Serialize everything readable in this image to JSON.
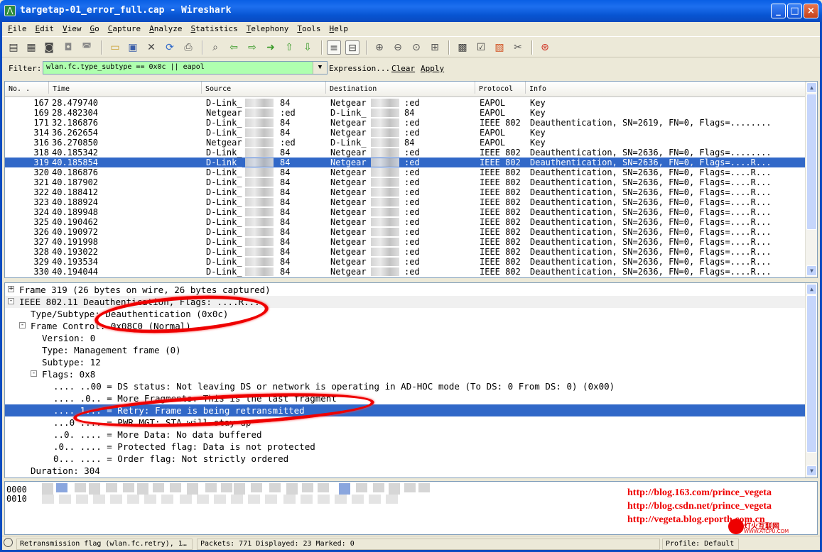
{
  "window": {
    "title": "targetap-01_error_full.cap - Wireshark",
    "min": "_",
    "max": "□",
    "close": "×"
  },
  "menu": [
    "File",
    "Edit",
    "View",
    "Go",
    "Capture",
    "Analyze",
    "Statistics",
    "Telephony",
    "Tools",
    "Help"
  ],
  "filter": {
    "label": "Filter:",
    "value": "wlan.fc.type_subtype == 0x0c || eapol",
    "expression": "Expression...",
    "clear": "Clear",
    "apply": "Apply"
  },
  "packet_list": {
    "columns": [
      "No. .",
      "Time",
      "Source",
      "Destination",
      "Protocol",
      "Info"
    ],
    "rows": [
      {
        "no": "167",
        "time": "28.479740",
        "src": "D-Link_",
        "srcs": "84",
        "dst": "Netgear",
        "dsts": ":ed",
        "proto": "EAPOL",
        "info": "Key"
      },
      {
        "no": "169",
        "time": "28.482304",
        "src": "Netgear",
        "srcs": ":ed",
        "dst": "D-Link_",
        "dsts": "84",
        "proto": "EAPOL",
        "info": "Key"
      },
      {
        "no": "171",
        "time": "32.186876",
        "src": "D-Link_",
        "srcs": "84",
        "dst": "Netgear",
        "dsts": ":ed",
        "proto": "IEEE 802",
        "info": "Deauthentication, SN=2619, FN=0, Flags=........"
      },
      {
        "no": "314",
        "time": "36.262654",
        "src": "D-Link_",
        "srcs": "84",
        "dst": "Netgear",
        "dsts": ":ed",
        "proto": "EAPOL",
        "info": "Key"
      },
      {
        "no": "316",
        "time": "36.270850",
        "src": "Netgear",
        "srcs": ":ed",
        "dst": "D-Link_",
        "dsts": "84",
        "proto": "EAPOL",
        "info": "Key"
      },
      {
        "no": "318",
        "time": "40.185342",
        "src": "D-Link_",
        "srcs": "84",
        "dst": "Netgear",
        "dsts": ":ed",
        "proto": "IEEE 802",
        "info": "Deauthentication, SN=2636, FN=0, Flags=........"
      },
      {
        "no": "319",
        "time": "40.185854",
        "src": "D-Link_",
        "srcs": "84",
        "dst": "Netgear",
        "dsts": ":ed",
        "proto": "IEEE 802",
        "info": "Deauthentication, SN=2636, FN=0, Flags=....R..."
      },
      {
        "no": "320",
        "time": "40.186876",
        "src": "D-Link_",
        "srcs": "84",
        "dst": "Netgear",
        "dsts": ":ed",
        "proto": "IEEE 802",
        "info": "Deauthentication, SN=2636, FN=0, Flags=....R..."
      },
      {
        "no": "321",
        "time": "40.187902",
        "src": "D-Link_",
        "srcs": "84",
        "dst": "Netgear",
        "dsts": ":ed",
        "proto": "IEEE 802",
        "info": "Deauthentication, SN=2636, FN=0, Flags=....R..."
      },
      {
        "no": "322",
        "time": "40.188412",
        "src": "D-Link_",
        "srcs": "84",
        "dst": "Netgear",
        "dsts": ":ed",
        "proto": "IEEE 802",
        "info": "Deauthentication, SN=2636, FN=0, Flags=....R..."
      },
      {
        "no": "323",
        "time": "40.188924",
        "src": "D-Link_",
        "srcs": "84",
        "dst": "Netgear",
        "dsts": ":ed",
        "proto": "IEEE 802",
        "info": "Deauthentication, SN=2636, FN=0, Flags=....R..."
      },
      {
        "no": "324",
        "time": "40.189948",
        "src": "D-Link_",
        "srcs": "84",
        "dst": "Netgear",
        "dsts": ":ed",
        "proto": "IEEE 802",
        "info": "Deauthentication, SN=2636, FN=0, Flags=....R..."
      },
      {
        "no": "325",
        "time": "40.190462",
        "src": "D-Link_",
        "srcs": "84",
        "dst": "Netgear",
        "dsts": ":ed",
        "proto": "IEEE 802",
        "info": "Deauthentication, SN=2636, FN=0, Flags=....R..."
      },
      {
        "no": "326",
        "time": "40.190972",
        "src": "D-Link_",
        "srcs": "84",
        "dst": "Netgear",
        "dsts": ":ed",
        "proto": "IEEE 802",
        "info": "Deauthentication, SN=2636, FN=0, Flags=....R..."
      },
      {
        "no": "327",
        "time": "40.191998",
        "src": "D-Link_",
        "srcs": "84",
        "dst": "Netgear",
        "dsts": ":ed",
        "proto": "IEEE 802",
        "info": "Deauthentication, SN=2636, FN=0, Flags=....R..."
      },
      {
        "no": "328",
        "time": "40.193022",
        "src": "D-Link_",
        "srcs": "84",
        "dst": "Netgear",
        "dsts": ":ed",
        "proto": "IEEE 802",
        "info": "Deauthentication, SN=2636, FN=0, Flags=....R..."
      },
      {
        "no": "329",
        "time": "40.193534",
        "src": "D-Link_",
        "srcs": "84",
        "dst": "Netgear",
        "dsts": ":ed",
        "proto": "IEEE 802",
        "info": "Deauthentication, SN=2636, FN=0, Flags=....R..."
      },
      {
        "no": "330",
        "time": "40.194044",
        "src": "D-Link_",
        "srcs": "84",
        "dst": "Netgear",
        "dsts": ":ed",
        "proto": "IEEE 802",
        "info": "Deauthentication, SN=2636, FN=0, Flags=....R..."
      }
    ],
    "selected_no": "319"
  },
  "details": [
    {
      "text": "Frame 319 (26 bytes on wire, 26 bytes captured)",
      "exp": "+"
    },
    {
      "text": "IEEE 802.11 Deauthentication, Flags: ....R...",
      "exp": "-"
    },
    {
      "text": "Type/Subtype: Deauthentication (0x0c)",
      "exp": ""
    },
    {
      "text": "Frame Control: 0x08C0 (Normal)",
      "exp": "-"
    },
    {
      "text": "Version: 0",
      "exp": ""
    },
    {
      "text": "Type: Management frame (0)",
      "exp": ""
    },
    {
      "text": "Subtype: 12",
      "exp": ""
    },
    {
      "text": "Flags: 0x8",
      "exp": "-"
    },
    {
      "text": ".... ..00 = DS status: Not leaving DS or network is operating in AD-HOC mode (To DS: 0 From DS: 0) (0x00)",
      "exp": ""
    },
    {
      "text": ".... .0.. = More Fragments: This is the last fragment",
      "exp": ""
    },
    {
      "text": ".... 1... = Retry: Frame is being retransmitted",
      "exp": ""
    },
    {
      "text": "...0 .... = PWR MGT: STA will stay up",
      "exp": ""
    },
    {
      "text": "..0. .... = More Data: No data buffered",
      "exp": ""
    },
    {
      "text": ".0.. .... = Protected flag: Data is not protected",
      "exp": ""
    },
    {
      "text": "0... .... = Order flag: Not strictly ordered",
      "exp": ""
    },
    {
      "text": "Duration: 304",
      "exp": ""
    }
  ],
  "hex": {
    "offsets": [
      "0000",
      "0010"
    ]
  },
  "watermarks": [
    "http://blog.163.com/prince_vegeta",
    "http://blog.csdn.net/prince_vegeta",
    "http://vegeta.blog.eporth.com.cn"
  ],
  "logo_text": {
    "cn": "灯火互联网",
    "url": "WWW.ATCPU.COM"
  },
  "status": {
    "field": "Retransmission flag (wlan.fc.retry), 1…",
    "packets": "Packets: 771 Displayed: 23 Marked: 0",
    "profile": "Profile: Default"
  },
  "colors": {
    "selection": "#3168c8",
    "filter_ok": "#afffaf",
    "highlight": "#e00000",
    "title": "#0a5fe4"
  }
}
